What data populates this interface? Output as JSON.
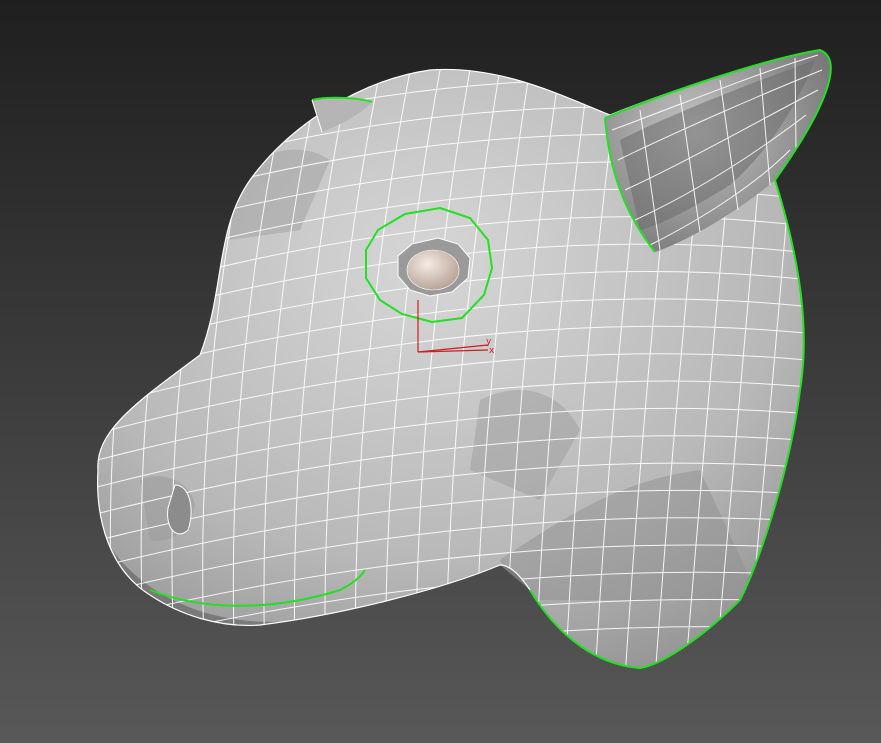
{
  "viewport": {
    "background_top": "#222222",
    "background_bottom": "#555555",
    "mesh_fill": "#bdbdbd",
    "mesh_shadow": "#6e6e6e",
    "wire_color": "#ffffff",
    "selection_color": "#22e022",
    "eye_color": "#e7d6cc"
  },
  "gizmo": {
    "x_label": "x",
    "y_label": "y",
    "axis_color": "#cc2020"
  }
}
